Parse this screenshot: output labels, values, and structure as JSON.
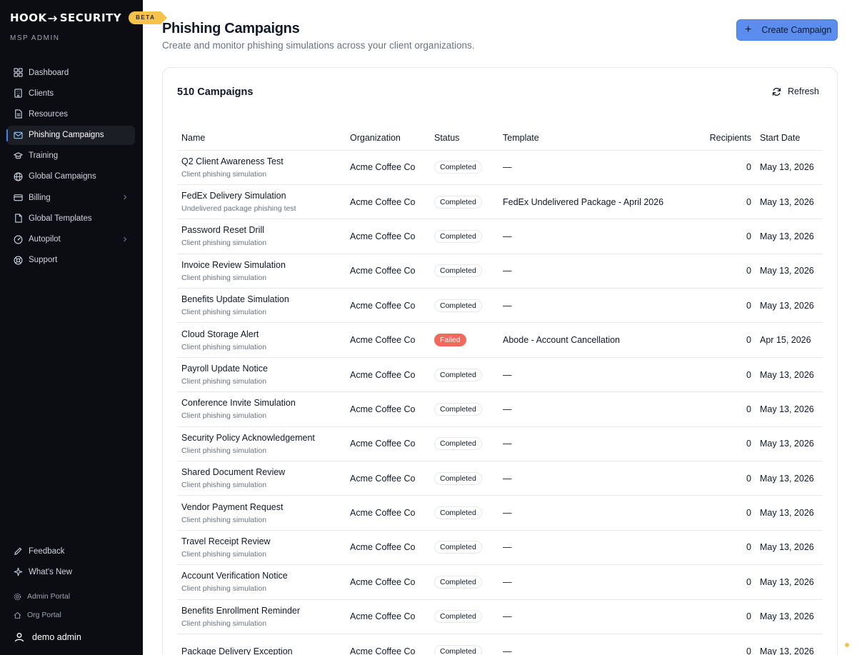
{
  "brand": {
    "left": "HOOK",
    "right": "SECURITY",
    "badge": "BETA",
    "sub": "MSP ADMIN"
  },
  "nav": [
    {
      "label": "Dashboard",
      "icon": "dashboard-icon"
    },
    {
      "label": "Clients",
      "icon": "building-icon"
    },
    {
      "label": "Resources",
      "icon": "document-icon"
    },
    {
      "label": "Phishing Campaigns",
      "icon": "mail-icon",
      "active": true
    },
    {
      "label": "Training",
      "icon": "graduation-cap-icon"
    },
    {
      "label": "Global Campaigns",
      "icon": "globe-icon"
    },
    {
      "label": "Billing",
      "icon": "credit-card-icon",
      "chevron": true
    },
    {
      "label": "Global Templates",
      "icon": "template-icon"
    },
    {
      "label": "Autopilot",
      "icon": "gauge-icon",
      "chevron": true
    },
    {
      "label": "Support",
      "icon": "lifebuoy-icon"
    }
  ],
  "footer": {
    "feedback": "Feedback",
    "whats_new": "What's New",
    "admin_portal": "Admin Portal",
    "org_portal": "Org Portal",
    "user": "demo admin"
  },
  "header": {
    "title": "Phishing Campaigns",
    "subtitle": "Create and monitor phishing simulations across your client organizations.",
    "create_button": "Create Campaign"
  },
  "card": {
    "count": "510 Campaigns",
    "refresh": "Refresh"
  },
  "table": {
    "columns": [
      "Name",
      "Organization",
      "Status",
      "Template",
      "Recipients",
      "Start Date"
    ],
    "rows": [
      {
        "name": "Q2 Client Awareness Test",
        "desc": "Client phishing simulation",
        "org": "Acme Coffee Co",
        "status": "Completed",
        "template": "—",
        "recipients": "0",
        "date": "May 13, 2026"
      },
      {
        "name": "FedEx Delivery Simulation",
        "desc": "Undelivered package phishing test",
        "org": "Acme Coffee Co",
        "status": "Completed",
        "template": "FedEx Undelivered Package - April 2026",
        "recipients": "0",
        "date": "May 13, 2026"
      },
      {
        "name": "Password Reset Drill",
        "desc": "Client phishing simulation",
        "org": "Acme Coffee Co",
        "status": "Completed",
        "template": "—",
        "recipients": "0",
        "date": "May 13, 2026"
      },
      {
        "name": "Invoice Review Simulation",
        "desc": "Client phishing simulation",
        "org": "Acme Coffee Co",
        "status": "Completed",
        "template": "—",
        "recipients": "0",
        "date": "May 13, 2026"
      },
      {
        "name": "Benefits Update Simulation",
        "desc": "Client phishing simulation",
        "org": "Acme Coffee Co",
        "status": "Completed",
        "template": "—",
        "recipients": "0",
        "date": "May 13, 2026"
      },
      {
        "name": "Cloud Storage Alert",
        "desc": "Client phishing simulation",
        "org": "Acme Coffee Co",
        "status": "Failed",
        "template": "Abode - Account Cancellation",
        "recipients": "0",
        "date": "Apr 15, 2026"
      },
      {
        "name": "Payroll Update Notice",
        "desc": "Client phishing simulation",
        "org": "Acme Coffee Co",
        "status": "Completed",
        "template": "—",
        "recipients": "0",
        "date": "May 13, 2026"
      },
      {
        "name": "Conference Invite Simulation",
        "desc": "Client phishing simulation",
        "org": "Acme Coffee Co",
        "status": "Completed",
        "template": "—",
        "recipients": "0",
        "date": "May 13, 2026"
      },
      {
        "name": "Security Policy Acknowledgement",
        "desc": "Client phishing simulation",
        "org": "Acme Coffee Co",
        "status": "Completed",
        "template": "—",
        "recipients": "0",
        "date": "May 13, 2026"
      },
      {
        "name": "Shared Document Review",
        "desc": "Client phishing simulation",
        "org": "Acme Coffee Co",
        "status": "Completed",
        "template": "—",
        "recipients": "0",
        "date": "May 13, 2026"
      },
      {
        "name": "Vendor Payment Request",
        "desc": "Client phishing simulation",
        "org": "Acme Coffee Co",
        "status": "Completed",
        "template": "—",
        "recipients": "0",
        "date": "May 13, 2026"
      },
      {
        "name": "Travel Receipt Review",
        "desc": "Client phishing simulation",
        "org": "Acme Coffee Co",
        "status": "Completed",
        "template": "—",
        "recipients": "0",
        "date": "May 13, 2026"
      },
      {
        "name": "Account Verification Notice",
        "desc": "Client phishing simulation",
        "org": "Acme Coffee Co",
        "status": "Completed",
        "template": "—",
        "recipients": "0",
        "date": "May 13, 2026"
      },
      {
        "name": "Benefits Enrollment Reminder",
        "desc": "Client phishing simulation",
        "org": "Acme Coffee Co",
        "status": "Completed",
        "template": "—",
        "recipients": "0",
        "date": "May 13, 2026"
      },
      {
        "name": "Package Delivery Exception",
        "desc": "",
        "org": "Acme Coffee Co",
        "status": "Completed",
        "template": "—",
        "recipients": "0",
        "date": "May 13, 2026"
      }
    ]
  },
  "colors": {
    "sidebar_bg": "#0c0d12",
    "accent": "#5b8def",
    "beta": "#f5c24b",
    "failed": "#ef6a5d"
  }
}
